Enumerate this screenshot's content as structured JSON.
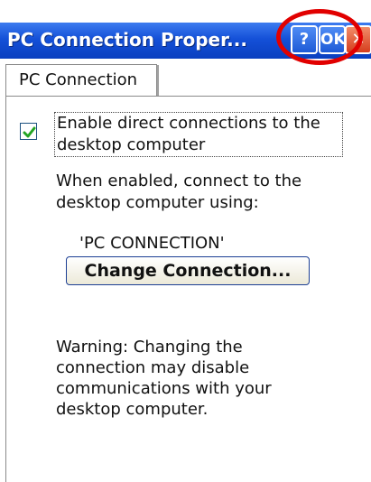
{
  "window": {
    "title": "PC Connection Proper...",
    "help_label": "?",
    "ok_label": "OK",
    "close_label": "✕"
  },
  "tabs": [
    {
      "label": "PC Connection"
    }
  ],
  "panel": {
    "checkbox": {
      "checked": true,
      "label_line1": "Enable direct connections to the",
      "label_line2": "desktop computer"
    },
    "info_line1": "When enabled, connect to the",
    "info_line2": "desktop computer using:",
    "connection_name": "'PC CONNECTION'",
    "change_button_label": "Change Connection...",
    "warning_lines": [
      "Warning: Changing the",
      "connection may disable",
      "communications with your",
      "desktop computer."
    ]
  },
  "colors": {
    "titlebar": "#1450d8",
    "callout_circle": "#e10000",
    "check": "#23a423"
  }
}
